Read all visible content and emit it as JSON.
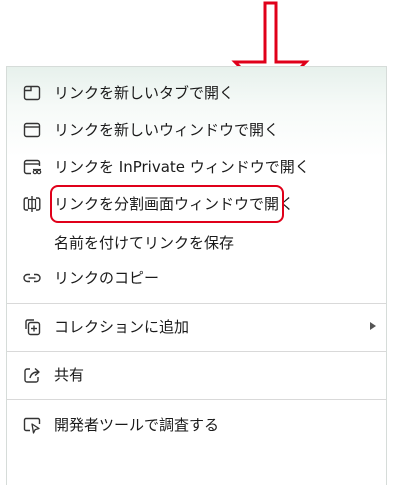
{
  "menu": {
    "items": [
      {
        "label": "リンクを新しいタブで開く",
        "icon": "new-tab-icon"
      },
      {
        "label": "リンクを新しいウィンドウで開く",
        "icon": "new-window-icon"
      },
      {
        "label": "リンクを InPrivate ウィンドウで開く",
        "icon": "inprivate-window-icon"
      },
      {
        "label": "リンクを分割画面ウィンドウで開く",
        "icon": "split-screen-icon"
      },
      {
        "label": "名前を付けてリンクを保存",
        "icon": ""
      },
      {
        "label": "リンクのコピー",
        "icon": "link-icon"
      },
      {
        "label": "コレクションに追加",
        "icon": "collections-icon",
        "submenu": true
      },
      {
        "label": "共有",
        "icon": "share-icon"
      },
      {
        "label": "開発者ツールで調査する",
        "icon": "devtools-inspect-icon"
      }
    ]
  },
  "annotation": {
    "arrow_color": "#e0001a",
    "highlight_color": "#e0001a",
    "highlighted_item": "名前を付けてリンクを保存"
  }
}
